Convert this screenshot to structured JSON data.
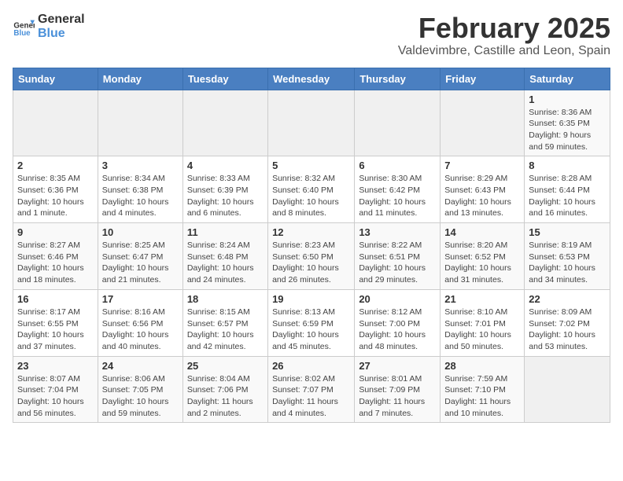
{
  "logo": {
    "line1": "General",
    "line2": "Blue"
  },
  "title": "February 2025",
  "location": "Valdevimbre, Castille and Leon, Spain",
  "days_of_week": [
    "Sunday",
    "Monday",
    "Tuesday",
    "Wednesday",
    "Thursday",
    "Friday",
    "Saturday"
  ],
  "weeks": [
    [
      {
        "day": "",
        "detail": ""
      },
      {
        "day": "",
        "detail": ""
      },
      {
        "day": "",
        "detail": ""
      },
      {
        "day": "",
        "detail": ""
      },
      {
        "day": "",
        "detail": ""
      },
      {
        "day": "",
        "detail": ""
      },
      {
        "day": "1",
        "detail": "Sunrise: 8:36 AM\nSunset: 6:35 PM\nDaylight: 9 hours and 59 minutes."
      }
    ],
    [
      {
        "day": "2",
        "detail": "Sunrise: 8:35 AM\nSunset: 6:36 PM\nDaylight: 10 hours and 1 minute."
      },
      {
        "day": "3",
        "detail": "Sunrise: 8:34 AM\nSunset: 6:38 PM\nDaylight: 10 hours and 4 minutes."
      },
      {
        "day": "4",
        "detail": "Sunrise: 8:33 AM\nSunset: 6:39 PM\nDaylight: 10 hours and 6 minutes."
      },
      {
        "day": "5",
        "detail": "Sunrise: 8:32 AM\nSunset: 6:40 PM\nDaylight: 10 hours and 8 minutes."
      },
      {
        "day": "6",
        "detail": "Sunrise: 8:30 AM\nSunset: 6:42 PM\nDaylight: 10 hours and 11 minutes."
      },
      {
        "day": "7",
        "detail": "Sunrise: 8:29 AM\nSunset: 6:43 PM\nDaylight: 10 hours and 13 minutes."
      },
      {
        "day": "8",
        "detail": "Sunrise: 8:28 AM\nSunset: 6:44 PM\nDaylight: 10 hours and 16 minutes."
      }
    ],
    [
      {
        "day": "9",
        "detail": "Sunrise: 8:27 AM\nSunset: 6:46 PM\nDaylight: 10 hours and 18 minutes."
      },
      {
        "day": "10",
        "detail": "Sunrise: 8:25 AM\nSunset: 6:47 PM\nDaylight: 10 hours and 21 minutes."
      },
      {
        "day": "11",
        "detail": "Sunrise: 8:24 AM\nSunset: 6:48 PM\nDaylight: 10 hours and 24 minutes."
      },
      {
        "day": "12",
        "detail": "Sunrise: 8:23 AM\nSunset: 6:50 PM\nDaylight: 10 hours and 26 minutes."
      },
      {
        "day": "13",
        "detail": "Sunrise: 8:22 AM\nSunset: 6:51 PM\nDaylight: 10 hours and 29 minutes."
      },
      {
        "day": "14",
        "detail": "Sunrise: 8:20 AM\nSunset: 6:52 PM\nDaylight: 10 hours and 31 minutes."
      },
      {
        "day": "15",
        "detail": "Sunrise: 8:19 AM\nSunset: 6:53 PM\nDaylight: 10 hours and 34 minutes."
      }
    ],
    [
      {
        "day": "16",
        "detail": "Sunrise: 8:17 AM\nSunset: 6:55 PM\nDaylight: 10 hours and 37 minutes."
      },
      {
        "day": "17",
        "detail": "Sunrise: 8:16 AM\nSunset: 6:56 PM\nDaylight: 10 hours and 40 minutes."
      },
      {
        "day": "18",
        "detail": "Sunrise: 8:15 AM\nSunset: 6:57 PM\nDaylight: 10 hours and 42 minutes."
      },
      {
        "day": "19",
        "detail": "Sunrise: 8:13 AM\nSunset: 6:59 PM\nDaylight: 10 hours and 45 minutes."
      },
      {
        "day": "20",
        "detail": "Sunrise: 8:12 AM\nSunset: 7:00 PM\nDaylight: 10 hours and 48 minutes."
      },
      {
        "day": "21",
        "detail": "Sunrise: 8:10 AM\nSunset: 7:01 PM\nDaylight: 10 hours and 50 minutes."
      },
      {
        "day": "22",
        "detail": "Sunrise: 8:09 AM\nSunset: 7:02 PM\nDaylight: 10 hours and 53 minutes."
      }
    ],
    [
      {
        "day": "23",
        "detail": "Sunrise: 8:07 AM\nSunset: 7:04 PM\nDaylight: 10 hours and 56 minutes."
      },
      {
        "day": "24",
        "detail": "Sunrise: 8:06 AM\nSunset: 7:05 PM\nDaylight: 10 hours and 59 minutes."
      },
      {
        "day": "25",
        "detail": "Sunrise: 8:04 AM\nSunset: 7:06 PM\nDaylight: 11 hours and 2 minutes."
      },
      {
        "day": "26",
        "detail": "Sunrise: 8:02 AM\nSunset: 7:07 PM\nDaylight: 11 hours and 4 minutes."
      },
      {
        "day": "27",
        "detail": "Sunrise: 8:01 AM\nSunset: 7:09 PM\nDaylight: 11 hours and 7 minutes."
      },
      {
        "day": "28",
        "detail": "Sunrise: 7:59 AM\nSunset: 7:10 PM\nDaylight: 11 hours and 10 minutes."
      },
      {
        "day": "",
        "detail": ""
      }
    ]
  ]
}
